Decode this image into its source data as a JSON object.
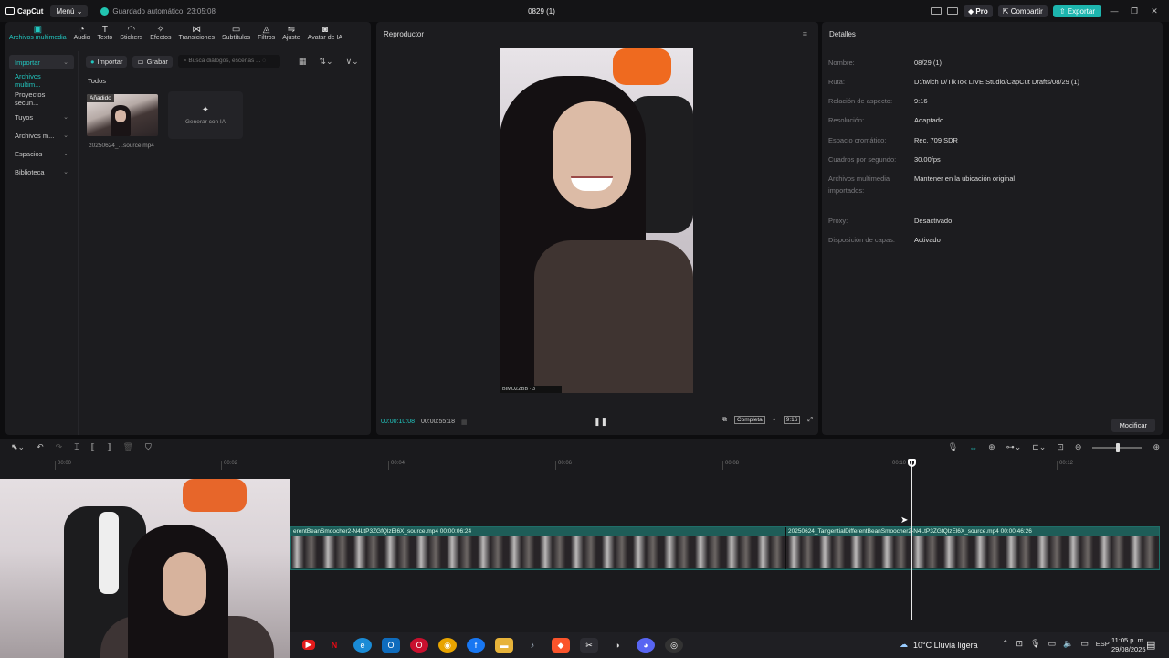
{
  "titlebar": {
    "logo_text": "CapCut",
    "menu_label": "Menú",
    "autosave_text": "Guardado automático: 23:05:08",
    "project_title": "0829 (1)",
    "pro_label": "Pro",
    "share_label": "Compartir",
    "export_label": "Exportar"
  },
  "tools": [
    {
      "label": "Archivos multimedia",
      "icon": "media-icon",
      "glyph": "▣",
      "active": true
    },
    {
      "label": "Audio",
      "icon": "audio-icon",
      "glyph": "◔"
    },
    {
      "label": "Texto",
      "icon": "text-icon",
      "glyph": "T"
    },
    {
      "label": "Stickers",
      "icon": "sticker-icon",
      "glyph": "◠"
    },
    {
      "label": "Efectos",
      "icon": "effects-icon",
      "glyph": "✧"
    },
    {
      "label": "Transiciones",
      "icon": "transitions-icon",
      "glyph": "⋈"
    },
    {
      "label": "Subtítulos",
      "icon": "subtitles-icon",
      "glyph": "▭"
    },
    {
      "label": "Filtros",
      "icon": "filters-icon",
      "glyph": "◬"
    },
    {
      "label": "Ajuste",
      "icon": "adjust-icon",
      "glyph": "⇋"
    },
    {
      "label": "Avatar de IA",
      "icon": "ai-avatar-icon",
      "glyph": "◙"
    }
  ],
  "sidebar": {
    "items": [
      {
        "label": "Importar",
        "chevron": "⌄"
      },
      {
        "label": "Archivos multim...",
        "chevron": ""
      },
      {
        "label": "Proyectos secun...",
        "chevron": ""
      },
      {
        "label": "Tuyos",
        "chevron": "⌄"
      },
      {
        "label": "Archivos m...",
        "chevron": "⌄"
      },
      {
        "label": "Espacios",
        "chevron": "⌄"
      },
      {
        "label": "Biblioteca",
        "chevron": "⌄"
      }
    ]
  },
  "media": {
    "import_label": "Importar",
    "record_label": "Grabar",
    "search_placeholder": "Busca diálogos, escenas ...",
    "section_label": "Todos",
    "clip_badge": "Añadido",
    "clip_name": "20250624_...source.mp4",
    "ai_card_label": "Generar con IA"
  },
  "player": {
    "title": "Reproductor",
    "video_tag": "BIMOZZBB · 3",
    "current_time": "00:00:10:08",
    "total_time": "00:00:55:18",
    "full_label": "Completa",
    "ratio_label": "9:16"
  },
  "details": {
    "title": "Detalles",
    "rows": [
      {
        "k": "Nombre:",
        "v": "08/29 (1)"
      },
      {
        "k": "Ruta:",
        "v": "D:/twich D/TikTok LIVE Studio/CapCut Drafts/08/29 (1)"
      },
      {
        "k": "Relación de aspecto:",
        "v": "9:16"
      },
      {
        "k": "Resolución:",
        "v": "Adaptado"
      },
      {
        "k": "Espacio cromático:",
        "v": "Rec. 709 SDR"
      },
      {
        "k": "Cuadros por segundo:",
        "v": "30.00fps"
      },
      {
        "k": "Archivos multimedia importados:",
        "v": "Mantener en la ubicación original"
      },
      {
        "k": "Proxy:",
        "v": "Desactivado"
      },
      {
        "k": "Disposición de capas:",
        "v": "Activado"
      }
    ],
    "modify_label": "Modificar"
  },
  "timeline": {
    "ticks": [
      "00:00",
      "00:02",
      "00:04",
      "00:06",
      "00:08",
      "00:10",
      "00:12"
    ],
    "clip1_label": "erentBeanSmoocher2-N4LtP3ZGfQlzEl6X_source.mp4   00:00:06:24",
    "clip2_label": "20250624_TangentialDifferentBeanSmoocher2-N4LtP3ZGfQlzEl6X_source.mp4   00:00:46:26"
  },
  "taskbar": {
    "weather": "10°C  Lluvia ligera",
    "lang": "ESP",
    "time": "11:05 p. m.",
    "date": "29/08/2025"
  },
  "colors": {
    "accent": "#22c7c0",
    "export": "#1db5ae",
    "panel": "#1c1c1f"
  }
}
